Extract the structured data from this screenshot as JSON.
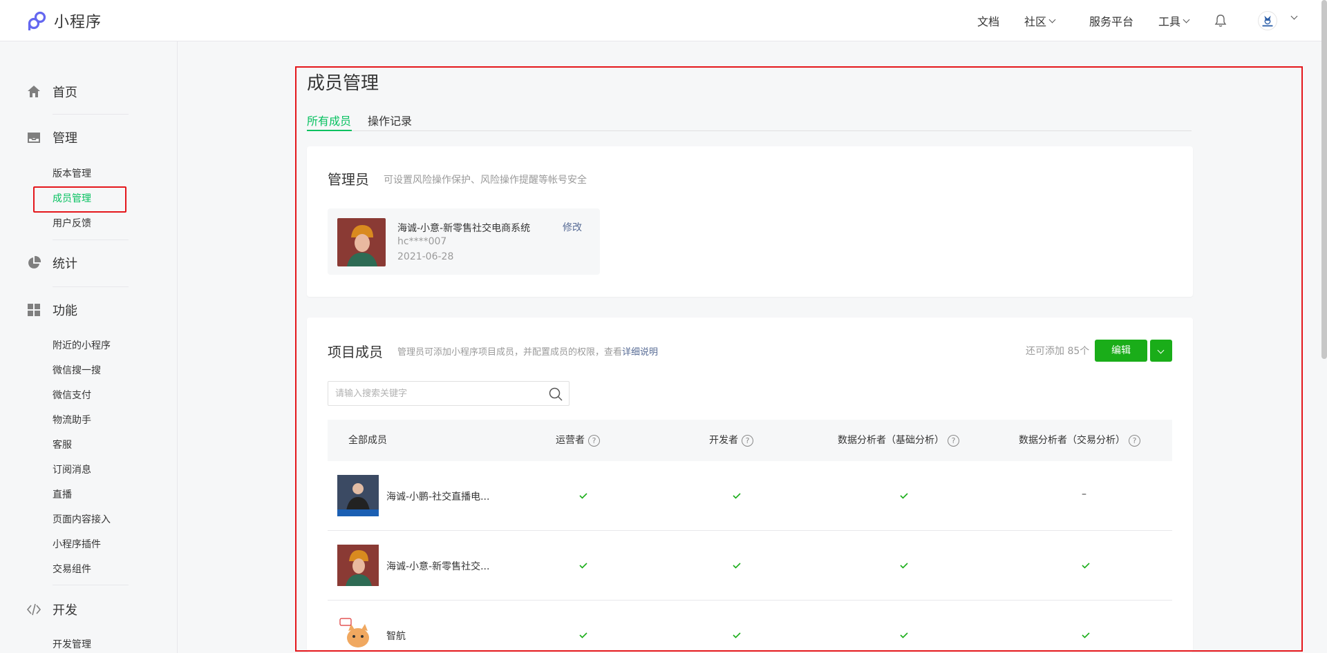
{
  "app": {
    "name": "小程序"
  },
  "topnav": {
    "items": [
      {
        "label": "文档"
      },
      {
        "label": "社区"
      },
      {
        "label": "服务平台"
      },
      {
        "label": "工具"
      }
    ]
  },
  "sidebar": {
    "home": "首页",
    "manage": "管理",
    "manage_items": [
      "版本管理",
      "成员管理",
      "用户反馈"
    ],
    "stats": "统计",
    "features": "功能",
    "feature_items": [
      "附近的小程序",
      "微信搜一搜",
      "微信支付",
      "物流助手",
      "客服",
      "订阅消息",
      "直播",
      "页面内容接入",
      "小程序插件",
      "交易组件"
    ],
    "dev": "开发",
    "dev_items": [
      "开发管理"
    ]
  },
  "main": {
    "title": "成员管理",
    "tabs": [
      "所有成员",
      "操作记录"
    ],
    "admin": {
      "title": "管理员",
      "desc": "可设置风险操作保护、风险操作提醒等帐号安全",
      "name": "海诚-小意-新零售社交电商系统",
      "id": "hc****007",
      "date": "2021-06-28",
      "edit": "修改"
    },
    "members": {
      "title": "项目成员",
      "desc": "管理员可添加小程序项目成员，并配置成员的权限，查看",
      "desc_link": "详细说明",
      "quota": "还可添加 85个",
      "edit_button": "编辑",
      "search_placeholder": "请输入搜索关键字",
      "columns": [
        "全部成员",
        "运营者",
        "开发者",
        "数据分析者（基础分析）",
        "数据分析者（交易分析）"
      ],
      "rows": [
        {
          "name": "海诚-小鹏-社交直播电...",
          "perms": [
            true,
            true,
            true,
            false
          ]
        },
        {
          "name": "海诚-小意-新零售社交...",
          "perms": [
            true,
            true,
            true,
            true
          ]
        },
        {
          "name": "智航",
          "perms": [
            true,
            true,
            true,
            true
          ]
        }
      ],
      "none_symbol": "–"
    }
  },
  "colors": {
    "accent": "#07c160",
    "button": "#1aad19",
    "link": "#576b95",
    "highlight": "#e4161b"
  }
}
